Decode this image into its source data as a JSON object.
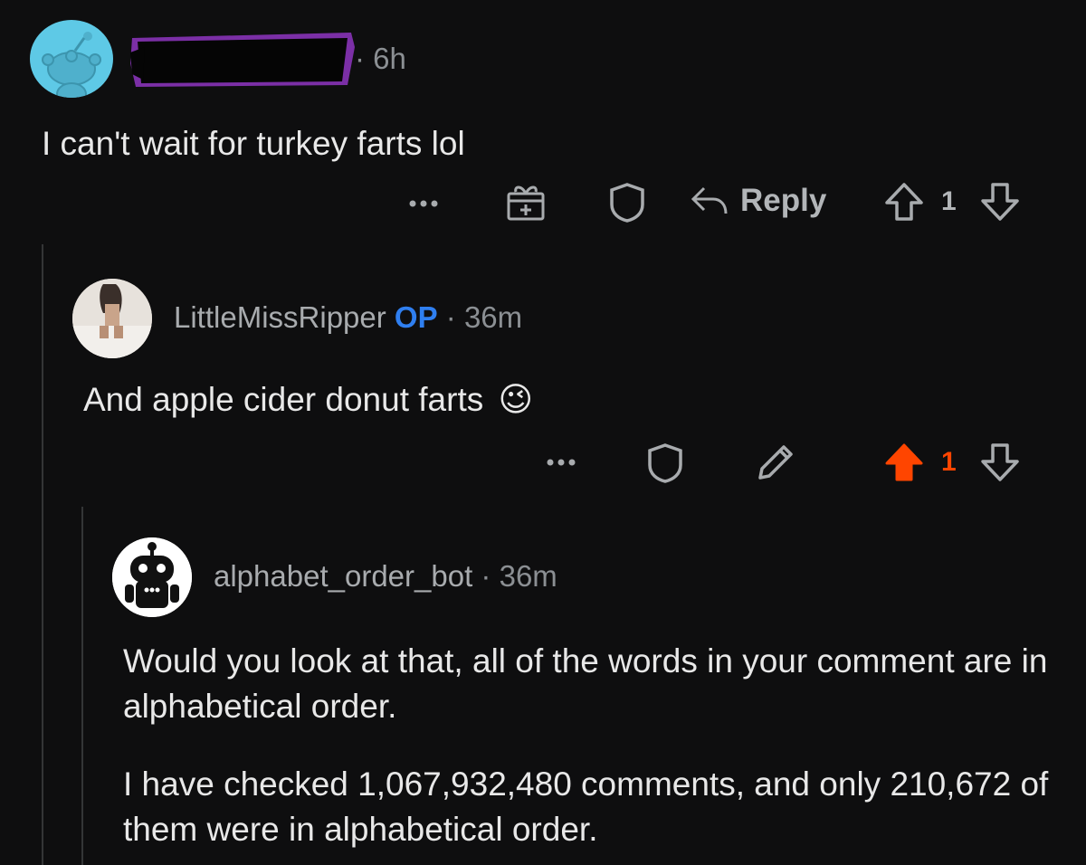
{
  "comments": [
    {
      "username": "",
      "time": "6h",
      "body": "I can't wait for turkey farts lol",
      "actions": {
        "reply": "Reply",
        "votes": "1"
      }
    },
    {
      "username": "LittleMissRipper",
      "op_badge": "OP",
      "time": "36m",
      "body": "And apple cider donut farts",
      "emoji": "😉",
      "actions": {
        "votes": "1",
        "upvoted": true
      }
    },
    {
      "username": "alphabet_order_bot",
      "time": "36m",
      "body_paragraphs": [
        "Would you look at that, all of the words in your comment are in alphabetical order.",
        "I have checked 1,067,932,480 comments, and only 210,672 of them were in alphabetical order."
      ]
    }
  ],
  "separator": "·",
  "colors": {
    "upvote": "#ff4500",
    "op": "#2f7ff0",
    "background": "#0e0e0f"
  }
}
